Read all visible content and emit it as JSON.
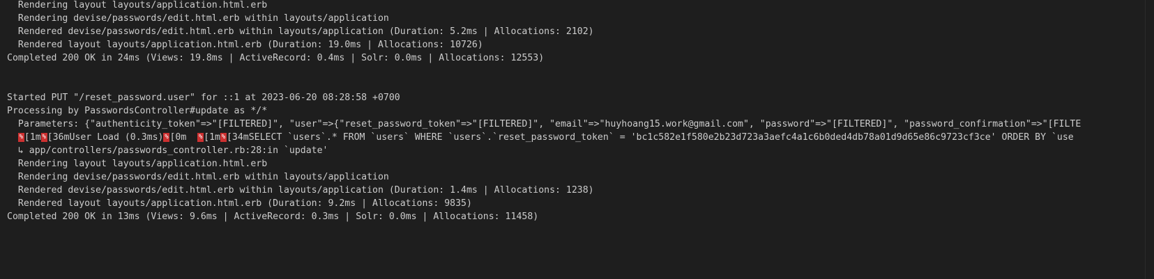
{
  "terminal": {
    "lines": [
      "  Rendering layout layouts/application.html.erb",
      "  Rendering devise/passwords/edit.html.erb within layouts/application",
      "  Rendered devise/passwords/edit.html.erb within layouts/application (Duration: 5.2ms | Allocations: 2102)",
      "  Rendered layout layouts/application.html.erb (Duration: 19.0ms | Allocations: 10726)",
      "Completed 200 OK in 24ms (Views: 19.8ms | ActiveRecord: 0.4ms | Solr: 0.0ms | Allocations: 12553)",
      "",
      "",
      "Started PUT \"/reset_password.user\" for ::1 at 2023-06-20 08:28:58 +0700",
      "Processing by PasswordsController#update as */*",
      "  Parameters: {\"authenticity_token\"=>\"[FILTERED]\", \"user\"=>{\"reset_password_token\"=>\"[FILTERED]\", \"email\"=>\"huyhoang15.work@gmail.com\", \"password\"=>\"[FILTERED]\", \"password_confirmation\"=>\"[FILTE"
    ],
    "sql_line": {
      "seg1": "[1m",
      "seg2": "[36mUser Load (0.3ms)",
      "seg3": "[0m  ",
      "seg4": "[1m",
      "seg5": "[34mSELECT `users`.* FROM `users` WHERE `users`.`reset_password_token` = 'bc1c582e1f580e2b23d723a3aefc4a1c6b0ded4db78a01d9d65e86c9723cf3ce' ORDER BY `use"
    },
    "lines_after": [
      "  ↳ app/controllers/passwords_controller.rb:28:in `update'",
      "  Rendering layout layouts/application.html.erb",
      "  Rendering devise/passwords/edit.html.erb within layouts/application",
      "  Rendered devise/passwords/edit.html.erb within layouts/application (Duration: 1.4ms | Allocations: 1238)",
      "  Rendered layout layouts/application.html.erb (Duration: 9.2ms | Allocations: 9835)",
      "Completed 200 OK in 13ms (Views: 9.6ms | ActiveRecord: 0.3ms | Solr: 0.0ms | Allocations: 11458)"
    ],
    "escape_glyph": "%",
    "colors": {
      "background": "#1e1e1e",
      "foreground": "#cccccc",
      "escape_badge": "#cd3131"
    }
  }
}
